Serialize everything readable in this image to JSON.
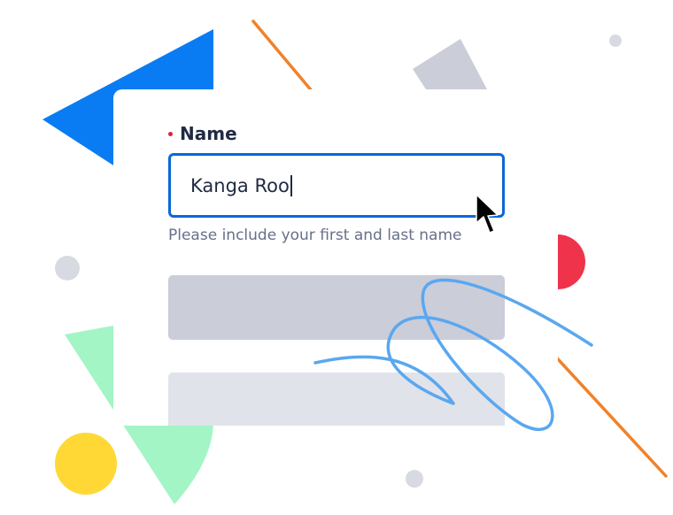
{
  "form": {
    "name_label": "Name",
    "name_value": "Kanga Roo",
    "name_helper": "Please include your first and last name"
  },
  "colors": {
    "accent": "#0a68d8",
    "required": "#e0203a",
    "text": "#1f2b43",
    "helper": "#66708a",
    "placeholder_dark": "#cbcdd9",
    "placeholder_light": "#e1e3ea",
    "shape_blue": "#0a7cf3",
    "shape_orange": "#f0822a",
    "shape_red": "#ee334b",
    "shape_green": "#a3f5c6",
    "shape_yellow": "#ffd836",
    "shape_gray": "#cbcdd9",
    "scribble": "#5aa7f0"
  },
  "icons": {
    "cursor": "mouse-pointer-icon"
  }
}
